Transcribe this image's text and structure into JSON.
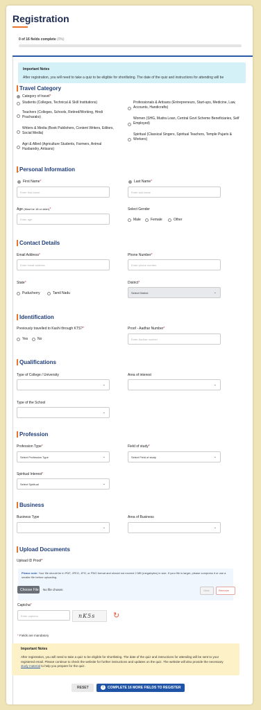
{
  "page": {
    "title": "Registration",
    "progress_label": "0 of 16 fields complete",
    "progress_percent_text": "(0%)",
    "progress_fraction": 0.0
  },
  "top_note": {
    "title": "Important Notes",
    "text": "After registration, you will need to take a quiz to be eligible for shortlisting. The date of the quiz and instructions for attending will be"
  },
  "travel_category": {
    "title": "Travel Category",
    "label": "Category of travel",
    "options_left": [
      "Students (Colleges, Technical & Skill Institutions)",
      "Teachers (Colleges, Schools, Retired/Working, Hindi Pracharaks)",
      "Writers & Media (Book Publishers, Content Writers, Editors, Social Media)",
      "Agri & Allied (Agriculture Students, Farmers, Animal Husbandry, Artisans)"
    ],
    "options_right": [
      "Professionals & Artisans (Entrepreneurs, Start-ups, Medicine, Law, Accounts, Handicrafts)",
      "Women (SHG, Mudra Loan, Central Govt Scheme Beneficiaries, Self Employed)",
      "Spiritual (Classical Singers, Spiritual Teachers, Temple Pujaris & Workers)"
    ]
  },
  "personal": {
    "title": "Personal Information",
    "first_name_label": "First Name",
    "first_name_placeholder": "Enter first name",
    "last_name_label": "Last Name",
    "last_name_placeholder": "Enter last name",
    "age_label": "Age",
    "age_hint": "(Must be 18 or older)",
    "age_placeholder": "Enter age",
    "gender_label": "Select Gender",
    "gender_options": [
      "Male",
      "Female",
      "Other"
    ]
  },
  "contact": {
    "title": "Contact Details",
    "email_label": "Email Address",
    "email_placeholder": "Enter email address",
    "phone_label": "Phone Number",
    "phone_placeholder": "Enter phone number",
    "state_label": "State",
    "state_options": [
      "Puducherry",
      "Tamil Nadu"
    ],
    "district_label": "District",
    "district_value": "Select District"
  },
  "identification": {
    "title": "Identification",
    "kts_label": "Previously travelled to Kashi through KTS?",
    "kts_options": [
      "Yes",
      "No"
    ],
    "proof_label": "Proof - Aadhar Number",
    "proof_placeholder": "Enter Aadhar number"
  },
  "qualifications": {
    "title": "Qualifications",
    "college_label": "Type of College / University",
    "interest_label": "Area of interest",
    "school_label": "Type of the School"
  },
  "profession": {
    "title": "Profession",
    "type_label": "Profession Type",
    "type_value": "Select Profession Type",
    "field_label": "Field of study",
    "field_value": "Select Field of study",
    "spiritual_label": "Spiritual Interest",
    "spiritual_value": "Select Spiritual"
  },
  "business": {
    "title": "Business",
    "type_label": "Business Type",
    "area_label": "Area of Business"
  },
  "upload": {
    "title": "Upload Documents",
    "id_label": "Upload ID Proof",
    "note_prefix": "Please note:",
    "note_text": "Your file should be in PDF, JPEG, JPG, or PNG format and should not exceed 2 MB (megabytes) in size. If your file is larger, please compress it or use a smaller file before uploading.",
    "choose_label": "Choose File",
    "no_file_text": "No file chosen",
    "view_label": "View",
    "remove_label": "Remove"
  },
  "captcha": {
    "label": "Captcha",
    "placeholder": "Enter captcha",
    "image_text": "nK5s"
  },
  "footer": {
    "mandatory_text": "Fields are mandatory",
    "note_title": "Important Notes",
    "note_text_part1": "After registration, you will need to take a quiz to be eligible for shortlisting. The date of the quiz and instructions for attending will be sent to your registered email. Please continue to check the website for further instructions and updates on the quiz. The website will also provide the necessary",
    "note_link": "study material",
    "note_text_part2": "to help you prepare for the quiz.",
    "reset_label": "RESET",
    "submit_icon": "!",
    "submit_label": "COMPLETE 16 MORE FIELDS TO REGISTER"
  },
  "icons": {
    "chevron": "chevron-down-icon",
    "refresh": "refresh-icon",
    "info": "info-icon"
  },
  "colors": {
    "accent": "#e8732b",
    "brand_blue": "#1f53a5",
    "page_bg": "#efe3b8"
  }
}
